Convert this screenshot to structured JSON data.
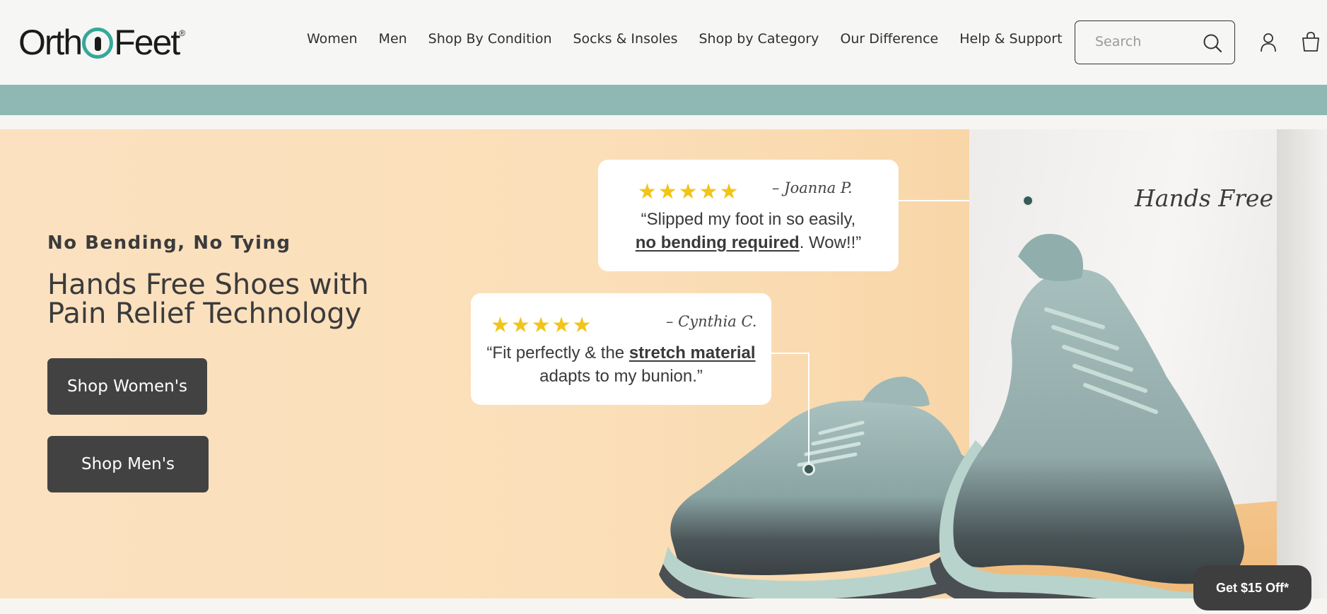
{
  "brand": {
    "logo_left": "Orth",
    "logo_right": "Feet",
    "logo_reg": "®"
  },
  "nav": {
    "items": [
      "Women",
      "Men",
      "Shop By Condition",
      "Socks & Insoles",
      "Shop by Category",
      "Our Difference",
      "Help & Support"
    ]
  },
  "search": {
    "placeholder": "Search",
    "icon": "search-icon"
  },
  "header_icons": {
    "account": "account-icon",
    "cart": "cart-icon"
  },
  "colors": {
    "teal_band": "#8fb8b4",
    "button": "#424242",
    "star": "#f2c418",
    "logo_accent": "#34a899"
  },
  "hero": {
    "eyebrow": "No Bending, No Tying",
    "headline_line1": "Hands Free Shoes with",
    "headline_line2": "Pain Relief Technology",
    "shop_women": "Shop Women's",
    "shop_men": "Shop Men's",
    "hands_free_label": "Hands Free"
  },
  "reviews": [
    {
      "stars": "★★★★★",
      "reviewer": "– Joanna P.",
      "quote_pre": "“Slipped my foot in so easily,",
      "quote_bold": "no bending required",
      "quote_post": ". Wow!!”"
    },
    {
      "stars": "★★★★★",
      "reviewer": "– Cynthia C.",
      "quote_pre": "“Fit perfectly & the ",
      "quote_bold": "stretch material",
      "quote_post": "adapts to my bunion.”"
    }
  ],
  "promo": {
    "label": "Get $15 Off*"
  }
}
